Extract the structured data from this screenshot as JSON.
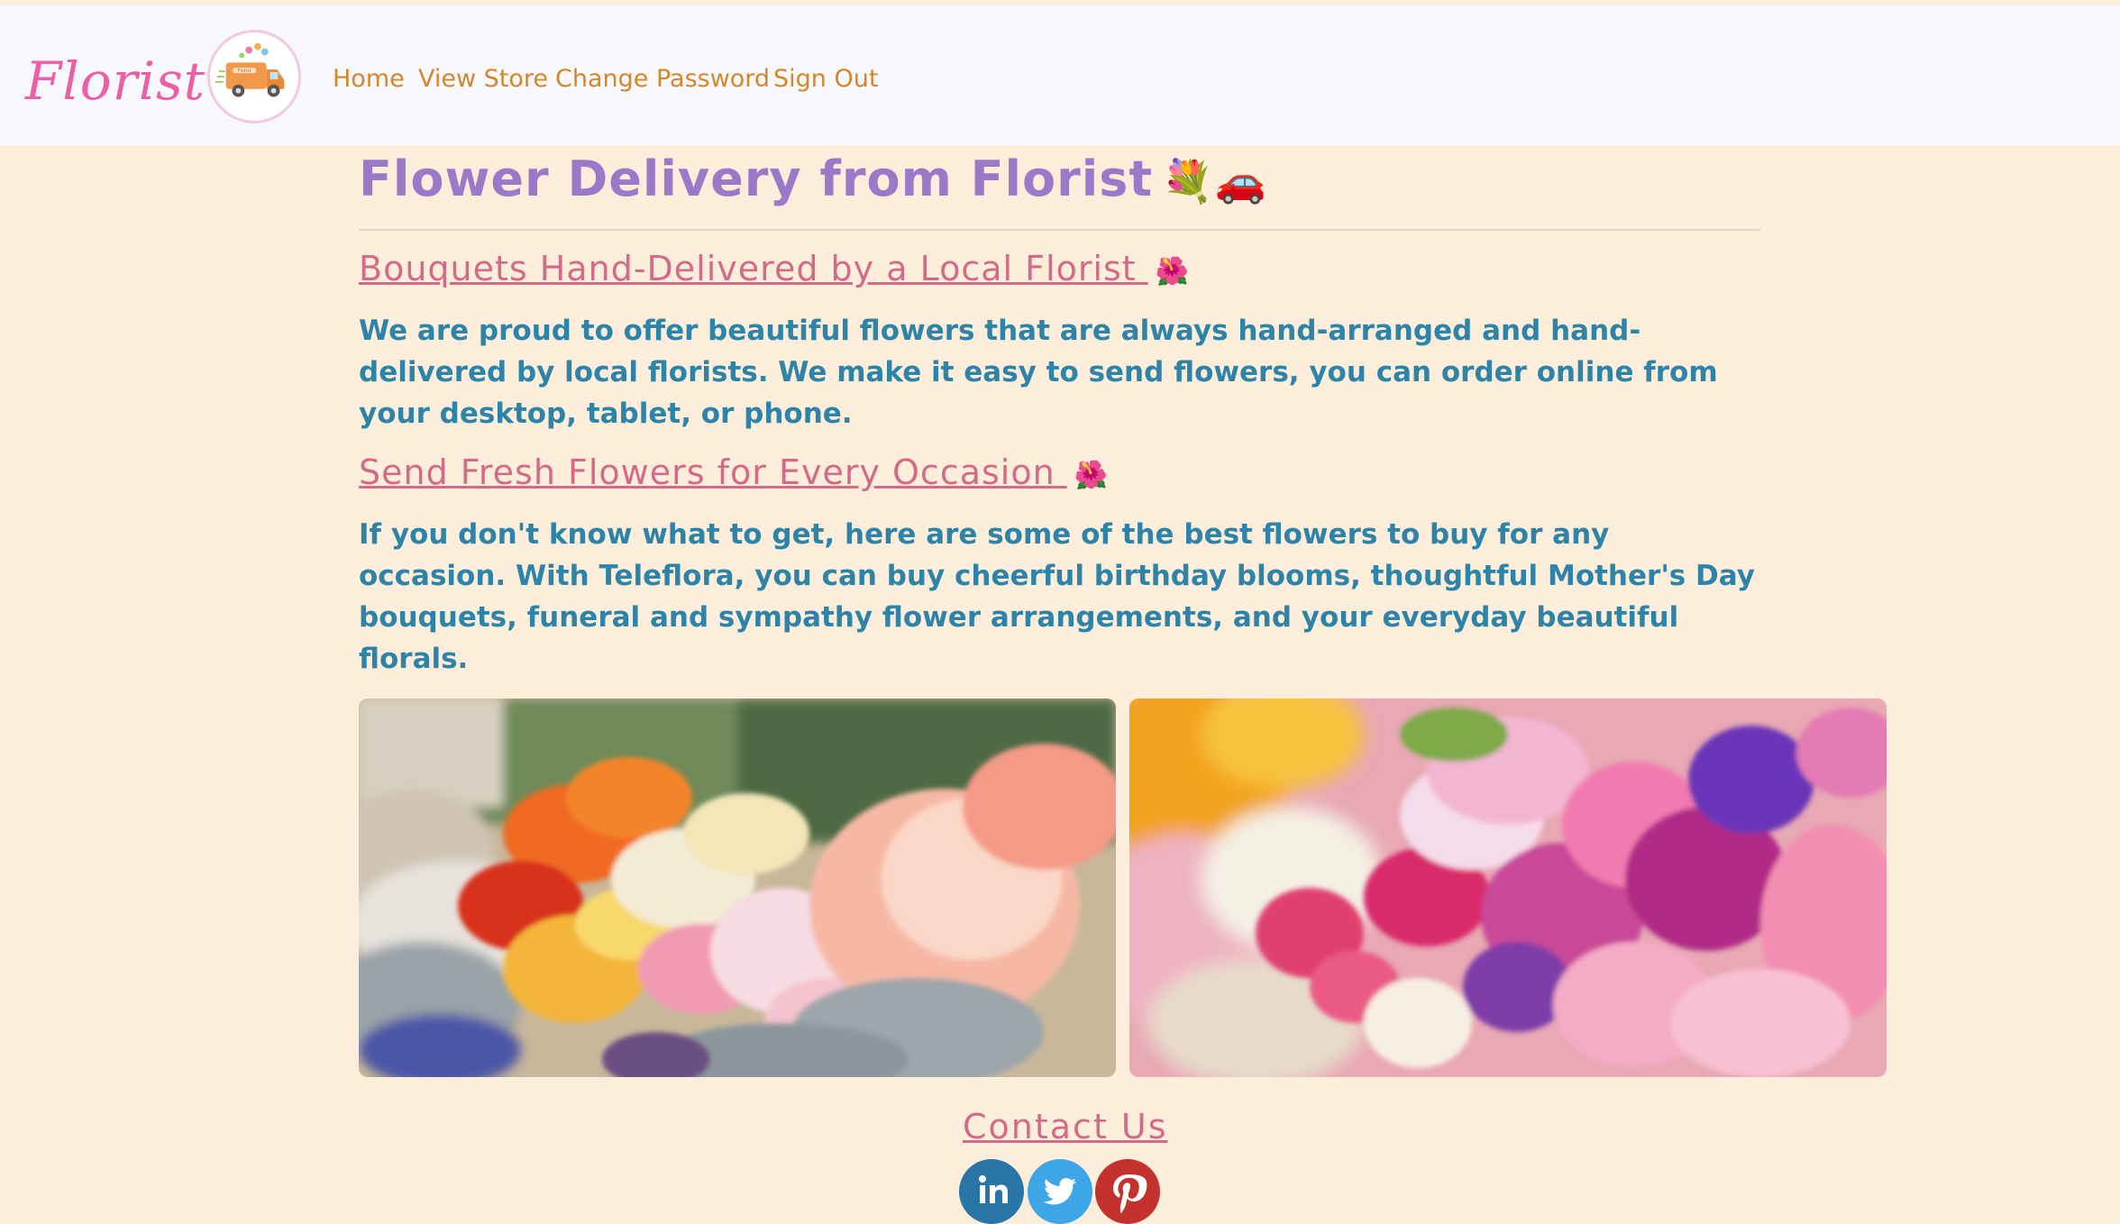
{
  "navbar": {
    "brand": "Florist",
    "logo_icon": "delivery-truck-logo",
    "links": [
      {
        "label": "Home"
      },
      {
        "label": "View Store"
      },
      {
        "label": "Change Password"
      },
      {
        "label": "Sign Out"
      }
    ]
  },
  "main": {
    "title": "Flower Delivery from Florist",
    "title_emoji": "💐🚗",
    "sections": [
      {
        "heading": "Bouquets Hand-Delivered by a Local Florist",
        "heading_emoji": "🌺",
        "text": "We are proud to offer beautiful flowers that are always hand-arranged and hand-delivered by local florists. We make it easy to send flowers, you can order online from your desktop, tablet, or phone."
      },
      {
        "heading": "Send Fresh Flowers for Every Occasion",
        "heading_emoji": "🌺",
        "text": "If you don't know what to get, here are some of the best flowers to buy for any occasion. With Teleflora, you can buy cheerful birthday blooms, thoughtful Mother's Day bouquets, funeral and sympathy flower arrangements, and your everyday beautiful florals."
      }
    ],
    "images": [
      {
        "name": "flower-market-photo"
      },
      {
        "name": "rose-bouquet-photo"
      }
    ]
  },
  "footer": {
    "contact_label": "Contact Us",
    "social": [
      {
        "icon": "linkedin-icon",
        "color": "#2a75a8"
      },
      {
        "icon": "twitter-icon",
        "color": "#3da6e6"
      },
      {
        "icon": "pinterest-icon",
        "color": "#c4322e"
      }
    ]
  },
  "colors": {
    "background": "#fdeedb",
    "navbar": "#f7f8fb",
    "brand": "#ec5fa8",
    "nav_link": "#d4862b",
    "title": "#9b79c9",
    "heading": "#d36a88",
    "body_text": "#2d84a8"
  }
}
